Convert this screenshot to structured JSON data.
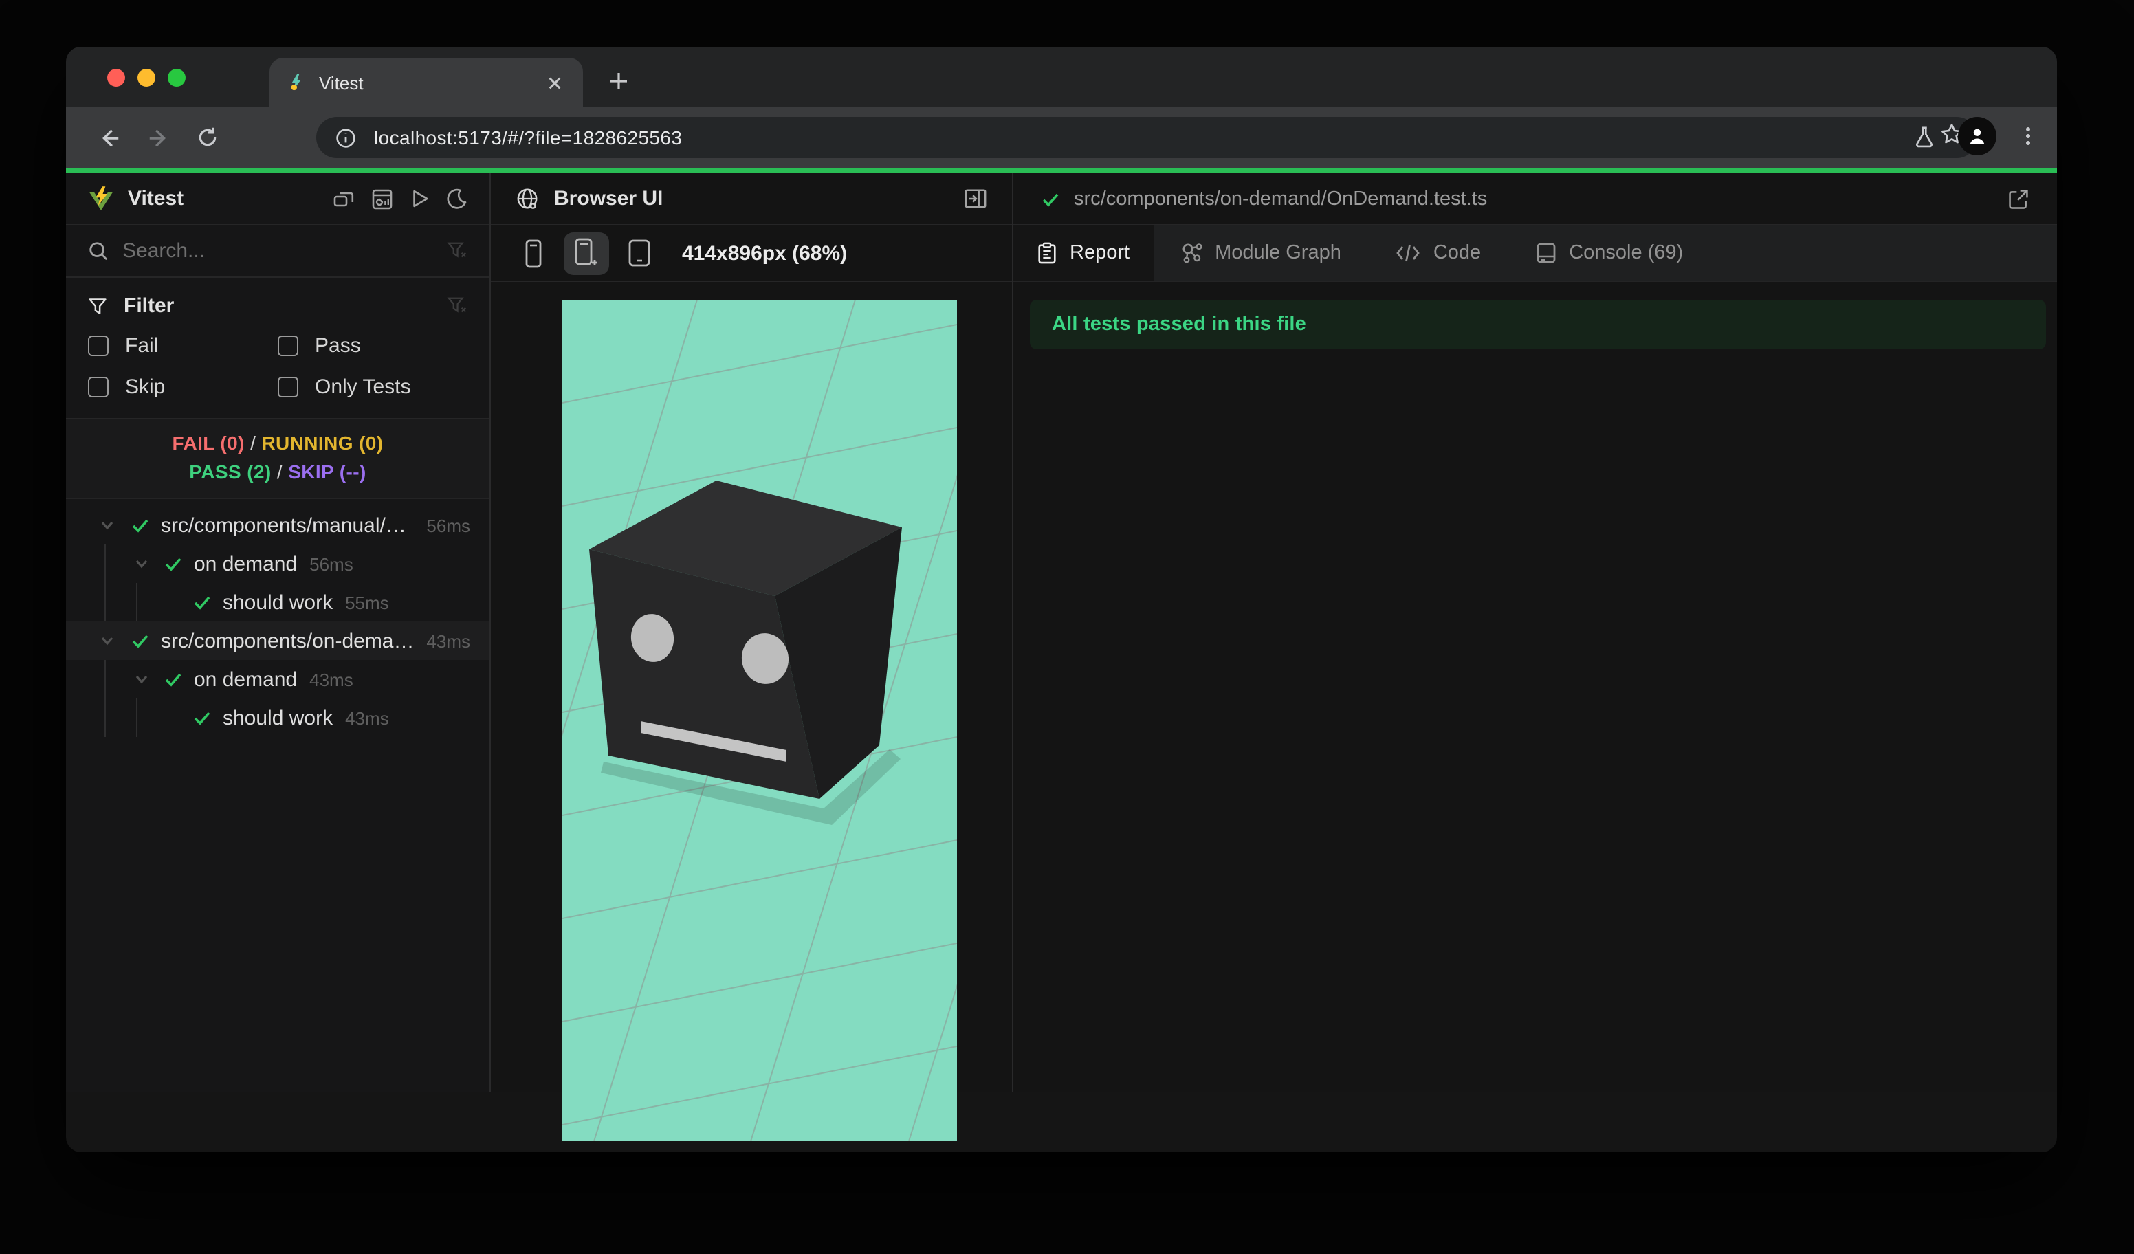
{
  "browser": {
    "tab_title": "Vitest",
    "url": "localhost:5173/#/?file=1828625563"
  },
  "sidebar": {
    "app_title": "Vitest",
    "search_placeholder": "Search...",
    "filter": {
      "title": "Filter",
      "options": [
        {
          "label": "Fail",
          "checked": false
        },
        {
          "label": "Pass",
          "checked": false
        },
        {
          "label": "Skip",
          "checked": false
        },
        {
          "label": "Only Tests",
          "checked": false
        }
      ]
    },
    "summary": {
      "fail": "FAIL (0)",
      "running": "RUNNING (0)",
      "pass": "PASS (2)",
      "skip": "SKIP (--)",
      "sep": "/"
    },
    "tree": [
      {
        "label": "src/components/manual/…",
        "duration": "56ms",
        "type": "file",
        "status": "pass",
        "selected": false
      },
      {
        "label": "on demand",
        "duration": "56ms",
        "type": "suite",
        "status": "pass",
        "selected": false
      },
      {
        "label": "should work",
        "duration": "55ms",
        "type": "test",
        "status": "pass",
        "selected": false
      },
      {
        "label": "src/components/on-dema…",
        "duration": "43ms",
        "type": "file",
        "status": "pass",
        "selected": true
      },
      {
        "label": "on demand",
        "duration": "43ms",
        "type": "suite",
        "status": "pass",
        "selected": false
      },
      {
        "label": "should work",
        "duration": "43ms",
        "type": "test",
        "status": "pass",
        "selected": false
      }
    ]
  },
  "preview": {
    "panel_title": "Browser UI",
    "viewport_label": "414x896px (68%)",
    "scene": {
      "description": "3D dark cube robot head with two eyes and mouth on gridded floor",
      "background_color": "#84dcc1",
      "cube_top_color": "#2f2f30",
      "cube_front_color": "#272728",
      "cube_side_color": "#1c1c1d",
      "eye_color": "#bdbdbd",
      "grid_line_color": "#8d9e97"
    }
  },
  "report": {
    "file_path": "src/components/on-demand/OnDemand.test.ts",
    "tabs": [
      {
        "label": "Report",
        "active": true
      },
      {
        "label": "Module Graph",
        "active": false
      },
      {
        "label": "Code",
        "active": false
      },
      {
        "label": "Console (69)",
        "active": false
      }
    ],
    "banner_text": "All tests passed in this file",
    "banner_text_color": "#3bd684",
    "banner_bg_color": "#152419"
  },
  "colors": {
    "progress_bar": "#2abd55",
    "pass_green": "#3ed17e",
    "fail_red": "#f56e6e",
    "running_yellow": "#e3b62f",
    "skip_purple": "#9b6ff0",
    "accent_check": "#30c963"
  }
}
